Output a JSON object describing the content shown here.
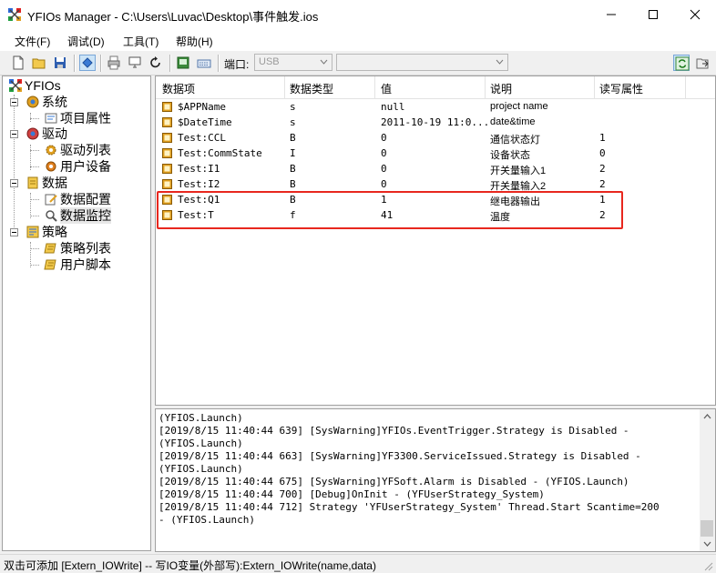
{
  "window": {
    "title": "YFIOs Manager - C:\\Users\\Luvac\\Desktop\\事件触发.ios"
  },
  "menu": [
    "文件(F)",
    "调试(D)",
    "工具(T)",
    "帮助(H)"
  ],
  "toolbar": {
    "port_label": "端口:",
    "port_value": "USB",
    "second_value": ""
  },
  "tree": {
    "root": "YFIOs",
    "nodes": [
      {
        "label": "系统"
      },
      {
        "label": "项目属性"
      },
      {
        "label": "驱动"
      },
      {
        "label": "驱动列表"
      },
      {
        "label": "用户设备"
      },
      {
        "label": "数据"
      },
      {
        "label": "数据配置"
      },
      {
        "label": "数据监控"
      },
      {
        "label": "策略"
      },
      {
        "label": "策略列表"
      },
      {
        "label": "用户脚本"
      }
    ]
  },
  "table": {
    "columns": [
      "数据项",
      "数据类型",
      "值",
      "说明",
      "读写属性"
    ],
    "rows": [
      {
        "name": "$APPName",
        "type": "s",
        "value": "null",
        "desc": "project name",
        "rw": ""
      },
      {
        "name": "$DateTime",
        "type": "s",
        "value": "2011-10-19 11:0...",
        "desc": "date&time",
        "rw": ""
      },
      {
        "name": "Test:CCL",
        "type": "B",
        "value": "0",
        "desc": "通信状态灯",
        "rw": "1"
      },
      {
        "name": "Test:CommState",
        "type": "I",
        "value": "0",
        "desc": "设备状态",
        "rw": "0"
      },
      {
        "name": "Test:I1",
        "type": "B",
        "value": "0",
        "desc": "开关量输入1",
        "rw": "2"
      },
      {
        "name": "Test:I2",
        "type": "B",
        "value": "0",
        "desc": "开关量输入2",
        "rw": "2"
      },
      {
        "name": "Test:Q1",
        "type": "B",
        "value": "1",
        "desc": "继电器输出",
        "rw": "1"
      },
      {
        "name": "Test:T",
        "type": "f",
        "value": "41",
        "desc": "温度",
        "rw": "2"
      }
    ]
  },
  "log": [
    "(YFIOS.Launch)",
    "[2019/8/15 11:40:44 639] [SysWarning]YFIOs.EventTrigger.Strategy is Disabled -",
    "(YFIOS.Launch)",
    "[2019/8/15 11:40:44 663] [SysWarning]YF3300.ServiceIssued.Strategy is Disabled -",
    "(YFIOS.Launch)",
    "[2019/8/15 11:40:44 675] [SysWarning]YFSoft.Alarm is Disabled - (YFIOS.Launch)",
    "[2019/8/15 11:40:44 700] [Debug]OnInit - (YFUserStrategy_System)",
    "[2019/8/15 11:40:44 712] Strategy 'YFUserStrategy_System' Thread.Start Scantime=200",
    "- (YFIOS.Launch)"
  ],
  "status": "双击可添加 [Extern_IOWrite] -- 写IO变量(外部写):Extern_IOWrite(name,data)",
  "colors": {
    "highlight": "#e8271e",
    "row_icon": "#e0a020"
  }
}
